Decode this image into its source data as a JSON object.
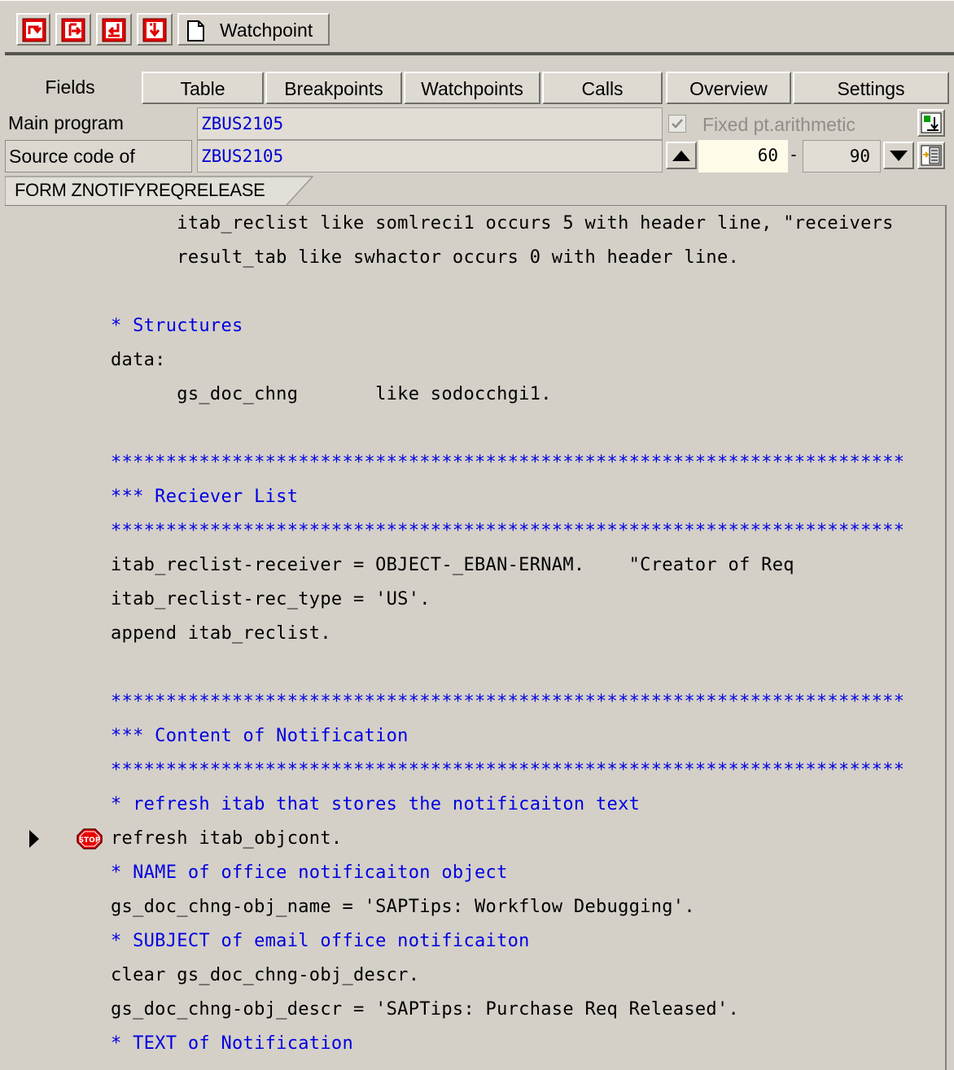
{
  "toolbar": {
    "icons": [
      "single-step-icon",
      "execute-icon",
      "return-icon",
      "continue-icon"
    ],
    "watchpoint_label": "Watchpoint",
    "watchpoint_icon": "new-document-icon"
  },
  "tabs": [
    {
      "label": "Fields",
      "active": true
    },
    {
      "label": "Table"
    },
    {
      "label": "Breakpoints"
    },
    {
      "label": "Watchpoints"
    },
    {
      "label": "Calls"
    },
    {
      "label": "Overview"
    },
    {
      "label": "Settings"
    }
  ],
  "main_program": {
    "label": "Main program",
    "value": "ZBUS2105"
  },
  "source_code_of": {
    "label": "Source code of",
    "value": "ZBUS2105"
  },
  "fixed_point": {
    "label": "Fixed pt.arithmetic",
    "checked": true
  },
  "range": {
    "from": "60",
    "separator": "-",
    "to": "90"
  },
  "form_tab": "FORM ZNOTIFYREQRELEASE",
  "code_lines": [
    {
      "text": "      itab_reclist like somlreci1 occurs 5 with header line, \"receivers",
      "type": "code"
    },
    {
      "text": "      result_tab like swhactor occurs 0 with header line.",
      "type": "code"
    },
    {
      "text": "",
      "type": "code"
    },
    {
      "text": "* Structures",
      "type": "comment"
    },
    {
      "text": "data:",
      "type": "code"
    },
    {
      "text": "      gs_doc_chng       like sodocchgi1.",
      "type": "code"
    },
    {
      "text": "",
      "type": "code"
    },
    {
      "text": "************************************************************************",
      "type": "comment"
    },
    {
      "text": "*** Reciever List",
      "type": "comment"
    },
    {
      "text": "************************************************************************",
      "type": "comment"
    },
    {
      "text": "itab_reclist-receiver = OBJECT-_EBAN-ERNAM.    \"Creator of Req",
      "type": "code"
    },
    {
      "text": "itab_reclist-rec_type = 'US'.",
      "type": "code"
    },
    {
      "text": "append itab_reclist.",
      "type": "code"
    },
    {
      "text": "",
      "type": "code"
    },
    {
      "text": "************************************************************************",
      "type": "comment"
    },
    {
      "text": "*** Content of Notification",
      "type": "comment"
    },
    {
      "text": "************************************************************************",
      "type": "comment"
    },
    {
      "text": "* refresh itab that stores the notificaiton text",
      "type": "comment"
    },
    {
      "text": "refresh itab_objcont.",
      "type": "code",
      "current": true,
      "breakpoint": true
    },
    {
      "text": "* NAME of office notificaiton object",
      "type": "comment"
    },
    {
      "text": "gs_doc_chng-obj_name = 'SAPTips: Workflow Debugging'.",
      "type": "code"
    },
    {
      "text": "* SUBJECT of email office notificaiton",
      "type": "comment"
    },
    {
      "text": "clear gs_doc_chng-obj_descr.",
      "type": "code"
    },
    {
      "text": "gs_doc_chng-obj_descr = 'SAPTips: Purchase Req Released'.",
      "type": "code"
    },
    {
      "text": "* TEXT of Notification",
      "type": "comment"
    }
  ],
  "colors": {
    "background": "#d4d0c8",
    "comment": "#0000e0",
    "field_value": "#0000d0",
    "disabled_text": "#8e8d86",
    "toolbar_icon_red": "#e00000"
  }
}
